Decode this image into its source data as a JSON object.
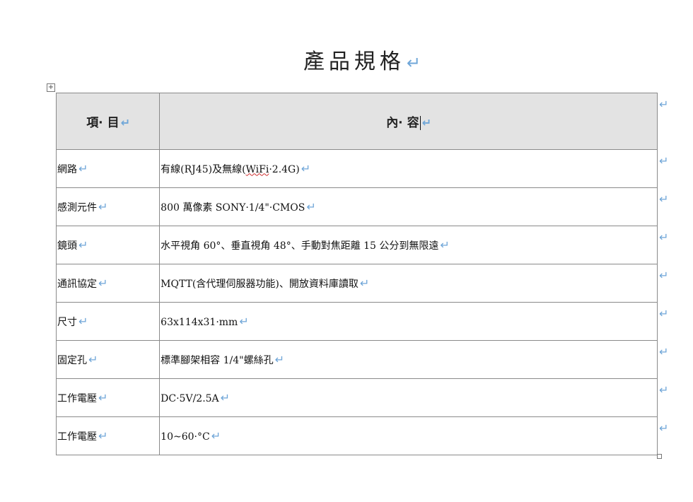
{
  "document": {
    "title": "產品規格",
    "return_mark": "↵"
  },
  "table": {
    "headers": {
      "item": "項· 目",
      "content": "內· 容"
    },
    "rows": [
      {
        "item": "網路",
        "content_pre": "有線(RJ45)及無線(",
        "content_wave": "WiFi",
        "content_post": "·2.4G)"
      },
      {
        "item": "感測元件",
        "content": "800 萬像素 SONY·1/4\"·CMOS"
      },
      {
        "item": "鏡頭",
        "content": "水平視角 60°、垂直視角 48°、手動對焦距離 15 公分到無限遠"
      },
      {
        "item": "通訊協定",
        "content": "MQTT(含代理伺服器功能)、開放資料庫讀取"
      },
      {
        "item": "尺寸",
        "content": "63x114x31·mm"
      },
      {
        "item": "固定孔",
        "content": "標準腳架相容 1/4\"螺絲孔"
      },
      {
        "item": "工作電壓",
        "content": "DC·5V/2.5A"
      },
      {
        "item": "工作電壓",
        "content": "10~60·°C"
      }
    ]
  },
  "icons": {
    "table_handle": "move-handle-icon",
    "resize_handle": "resize-handle-icon"
  }
}
